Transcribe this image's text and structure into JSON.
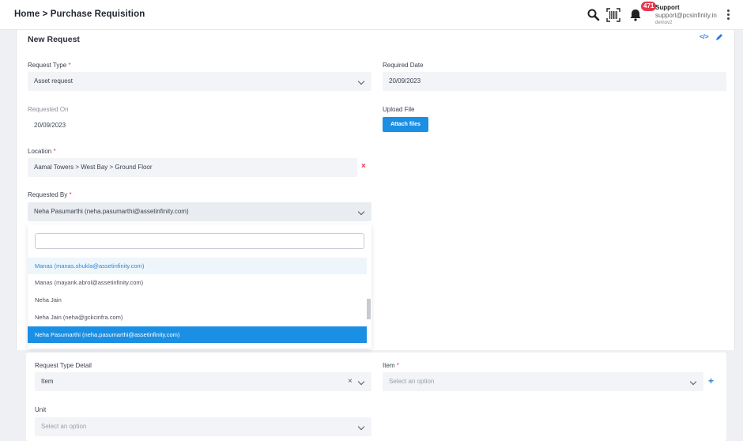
{
  "header": {
    "breadcrumb": "Home > Purchase Requisition",
    "notification_count": "471",
    "support_name": "Support",
    "support_email": "support@pcsinfinity.in",
    "support_sub": "demov2"
  },
  "form": {
    "title": "New Request",
    "request_type": {
      "label": "Request Type",
      "value": "Asset request"
    },
    "required_date": {
      "label": "Required Date",
      "value": "20/09/2023"
    },
    "requested_on": {
      "label": "Requested On",
      "value": "20/09/2023"
    },
    "upload_file": {
      "label": "Upload File",
      "button": "Attach files"
    },
    "location": {
      "label": "Location",
      "value": "Aamal Towers > West Bay > Ground Floor"
    },
    "requested_by": {
      "label": "Requested By",
      "value": "Neha Pasumarthi (neha.pasumarthi@assetinfinity.com)",
      "options": [
        "Manas (manas.shukla@assetinfinity.com)",
        "Manas (mayank.abrol@assetinfinity.com)",
        "Neha Jain",
        "Neha Jain (neha@gckcinfra.com)",
        "Neha Pasumarthi (neha.pasumarthi@assetinfinity.com)"
      ]
    }
  },
  "detail": {
    "request_type_detail": {
      "label": "Request Type Detail",
      "value": "Item"
    },
    "item": {
      "label": "Item",
      "placeholder": "Select an option"
    },
    "unit": {
      "label": "Unit",
      "placeholder": "Select an option"
    }
  },
  "colors": {
    "accent": "#1a8fe3",
    "required": "#e53950",
    "field_bg": "#f2f4f7"
  }
}
